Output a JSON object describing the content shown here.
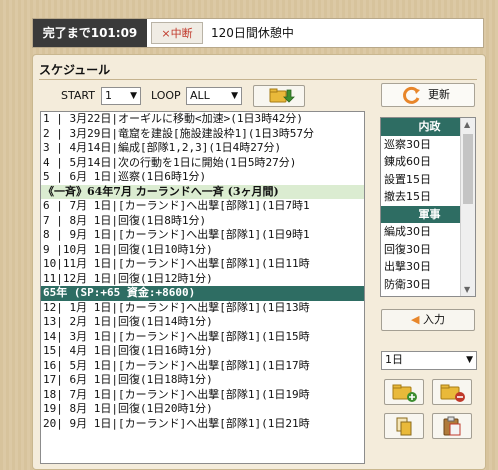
{
  "topbar": {
    "countdown": "完了まで101:09",
    "cancel_label": "×中断",
    "status": "120日間休憩中"
  },
  "schedule": {
    "title": "スケジュール",
    "start_label": "START",
    "start_value": "1",
    "loop_label": "LOOP",
    "loop_value": "ALL",
    "reload_label": "更新",
    "rows": [
      {
        "type": "entry",
        "text": "1 | 3月22日|オーギルに移動<加速>(1日3時42分)"
      },
      {
        "type": "entry",
        "text": "2 | 3月29日|竜窟を建設[施設建設枠1](1日3時57分"
      },
      {
        "type": "entry",
        "text": "3 | 4月14日|編成[部隊1,2,3](1日4時27分)"
      },
      {
        "type": "entry",
        "text": "4 | 5月14日|次の行動を1日に開始(1日5時27分)"
      },
      {
        "type": "entry",
        "text": "5 | 6月 1日|巡察(1日6時1分)"
      },
      {
        "type": "highlight",
        "text": "《一斉》64年7月 カーランドへ一斉 (3ヶ月間)"
      },
      {
        "type": "entry",
        "text": "6 | 7月 1日|[カーランド]へ出撃[部隊1](1日7時1"
      },
      {
        "type": "entry",
        "text": "7 | 8月 1日|回復(1日8時1分)"
      },
      {
        "type": "entry",
        "text": "8 | 9月 1日|[カーランド]へ出撃[部隊1](1日9時1"
      },
      {
        "type": "entry",
        "text": "9 |10月 1日|回復(1日10時1分)"
      },
      {
        "type": "entry",
        "text": "10|11月 1日|[カーランド]へ出撃[部隊1](1日11時"
      },
      {
        "type": "entry",
        "text": "11|12月 1日|回復(1日12時1分)"
      },
      {
        "type": "year",
        "text": " 65年 (SP:+65 資金:+8600)"
      },
      {
        "type": "entry",
        "text": "12| 1月 1日|[カーランド]へ出撃[部隊1](1日13時"
      },
      {
        "type": "entry",
        "text": "13| 2月 1日|回復(1日14時1分)"
      },
      {
        "type": "entry",
        "text": "14| 3月 1日|[カーランド]へ出撃[部隊1](1日15時"
      },
      {
        "type": "entry",
        "text": "15| 4月 1日|回復(1日16時1分)"
      },
      {
        "type": "entry",
        "text": "16| 5月 1日|[カーランド]へ出撃[部隊1](1日17時"
      },
      {
        "type": "entry",
        "text": "17| 6月 1日|回復(1日18時1分)"
      },
      {
        "type": "entry",
        "text": "18| 7月 1日|[カーランド]へ出撃[部隊1](1日19時"
      },
      {
        "type": "entry",
        "text": "19| 8月 1日|回復(1日20時1分)"
      },
      {
        "type": "entry",
        "text": "20| 9月 1日|[カーランド]へ出撃[部隊1](1日21時"
      }
    ]
  },
  "commands": {
    "items": [
      {
        "type": "head",
        "text": "内政"
      },
      {
        "type": "item",
        "text": "巡察30日"
      },
      {
        "type": "item",
        "text": "錬成60日"
      },
      {
        "type": "item",
        "text": "設置15日"
      },
      {
        "type": "item",
        "text": "撤去15日"
      },
      {
        "type": "head",
        "text": "軍事"
      },
      {
        "type": "item",
        "text": "編成30日"
      },
      {
        "type": "item",
        "text": "回復30日"
      },
      {
        "type": "item",
        "text": "出撃30日"
      },
      {
        "type": "item",
        "text": "防衛30日"
      }
    ],
    "enter_label": "入力",
    "day_value": "1日"
  },
  "icons": {
    "reload": "reload-icon",
    "move_down": "folder-arrow-icon",
    "add": "folder-add-icon",
    "remove": "folder-remove-icon",
    "copy": "copy-icon",
    "paste": "paste-icon",
    "enter": "arrow-left-icon"
  },
  "colors": {
    "accent_green": "#2e6d63",
    "highlight_green": "#dbecd1",
    "countdown_bg": "#3a3a3a",
    "cancel_red": "#c0392b",
    "reload_orange": "#e8862a"
  }
}
